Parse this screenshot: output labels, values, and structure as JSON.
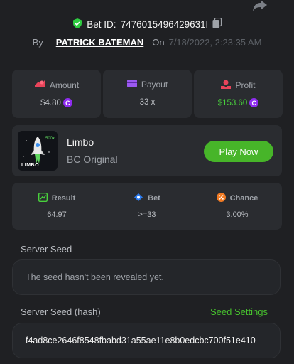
{
  "header": {
    "bet_id_label": "Bet ID:",
    "bet_id": "7476015496429631l",
    "by_label": "By",
    "username": "PATRICK BATEMAN",
    "on_label": "On",
    "datetime": "7/18/2022, 2:23:35 AM"
  },
  "stats": {
    "amount": {
      "label": "Amount",
      "value": "$4.80"
    },
    "payout": {
      "label": "Payout",
      "value": "33 x"
    },
    "profit": {
      "label": "Profit",
      "value": "$153.60"
    },
    "coin_glyph": "C"
  },
  "game": {
    "name": "Limbo",
    "subtitle": "BC Original",
    "play_label": "Play Now",
    "thumb_label": "LIMBO",
    "thumb_multiplier": "500x"
  },
  "result": {
    "result": {
      "label": "Result",
      "value": "64.97"
    },
    "bet": {
      "label": "Bet",
      "value": ">=33"
    },
    "chance": {
      "label": "Chance",
      "value": "3.00%"
    }
  },
  "server_seed": {
    "label": "Server Seed",
    "text": "The seed hasn't been revealed yet."
  },
  "server_seed_hash": {
    "label": "Server Seed (hash)",
    "settings_label": "Seed Settings",
    "hash": "f4ad8ce2646f8548fbabd31a55ae11e8b0edcbc700f51e410"
  },
  "colors": {
    "background": "#1f2023",
    "card": "#2a2c30",
    "accent_green": "#47b529",
    "profit_green": "#48d13c",
    "coin_purple": "#8f2cf0"
  }
}
